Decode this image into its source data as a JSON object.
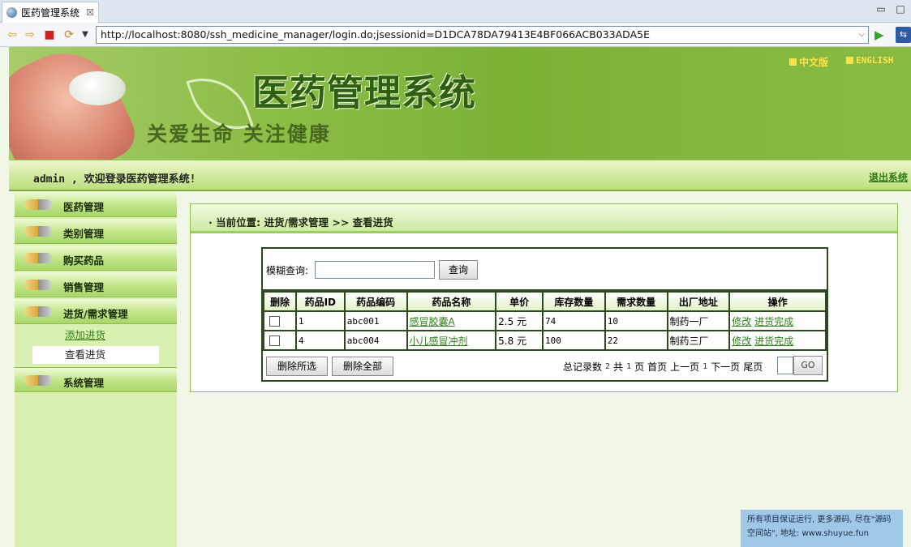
{
  "browser": {
    "tab_title": "医药管理系统",
    "tab_close": "☒",
    "url": "http://localhost:8080/ssh_medicine_manager/login.do;jsessionid=D1DCA78DA79413E4BF066ACB033ADA5E"
  },
  "banner": {
    "title": "医药管理系统",
    "slogan": "关爱生命  关注健康",
    "lang_cn": "中文版",
    "lang_en": "ENGLISH"
  },
  "welcome": {
    "text": "admin , 欢迎登录医药管理系统!",
    "logout": "退出系统"
  },
  "sidebar": {
    "items": [
      {
        "label": "医药管理"
      },
      {
        "label": "类别管理"
      },
      {
        "label": "购买药品"
      },
      {
        "label": "销售管理"
      },
      {
        "label": "进货/需求管理"
      },
      {
        "label": "系统管理"
      }
    ],
    "sub_items": [
      {
        "label": "添加进货"
      },
      {
        "label": "查看进货"
      }
    ]
  },
  "main": {
    "breadcrumb": "· 当前位置:  进货/需求管理 >> 查看进货",
    "search_label": "模糊查询:",
    "search_placeholder": "",
    "search_button": "查询",
    "columns": [
      "删除",
      "药品ID",
      "药品编码",
      "药品名称",
      "单价",
      "库存数量",
      "需求数量",
      "出厂地址",
      "操作"
    ],
    "rows": [
      {
        "id": "1",
        "code": "abc001",
        "name": "感冒胶囊A",
        "price": "2.5 元",
        "stock": "74",
        "demand": "10",
        "factory": "制药一厂",
        "edit": "修改",
        "done": "进货完成"
      },
      {
        "id": "4",
        "code": "abc004",
        "name": "小儿感冒冲剂",
        "price": "5.8 元",
        "stock": "100",
        "demand": "22",
        "factory": "制药三厂",
        "edit": "修改",
        "done": "进货完成"
      }
    ],
    "delete_selected": "删除所选",
    "delete_all": "删除全部",
    "pager": {
      "total_label": "总记录数",
      "total": "2",
      "gong": "共",
      "pages": "1",
      "ye": "页",
      "first": "首页",
      "prev": "上一页",
      "current": "1",
      "next": "下一页",
      "last": "尾页",
      "go": "GO"
    }
  },
  "watermark": {
    "line1": "所有项目保证运行, 更多源码, 尽在\"源码",
    "line2": "空间站\", 地址: www.shuyue.fun"
  }
}
